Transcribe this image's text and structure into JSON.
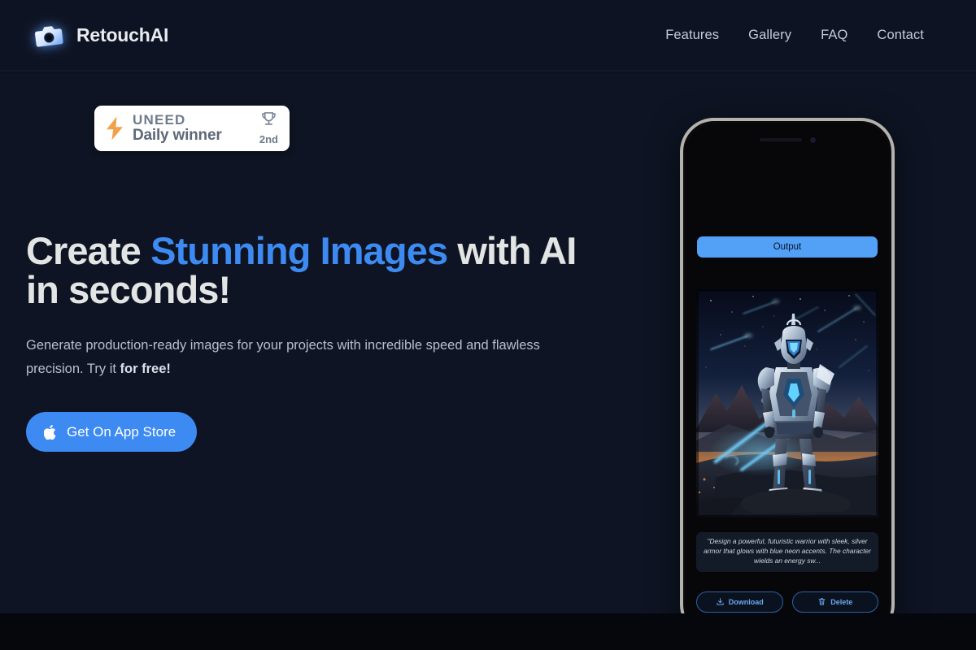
{
  "header": {
    "brand": {
      "name": "RetouchAI",
      "logo_icon": "camera-icon"
    },
    "nav": [
      {
        "label": "Features"
      },
      {
        "label": "Gallery"
      },
      {
        "label": "FAQ"
      },
      {
        "label": "Contact"
      }
    ]
  },
  "hero": {
    "badge": {
      "icon": "lightning-bolt-icon",
      "brand": "UNEED",
      "subtitle": "Daily winner",
      "trophy_icon": "trophy-icon",
      "rank": "2nd"
    },
    "headline": {
      "part1": "Create ",
      "accent": "Stunning Images",
      "part2": " with AI in seconds!"
    },
    "subheadline": {
      "text": "Generate production-ready images for your projects with incredible speed and flawless precision. Try it ",
      "bold": "for free!"
    },
    "cta": {
      "label": "Get On App Store",
      "icon": "apple-icon"
    }
  },
  "phone": {
    "tab": {
      "label": "Output"
    },
    "artwork": {
      "alt": "futuristic silver armored warrior holding a glowing blue energy sword on an alien rocky landscape at dusk"
    },
    "prompt": "\"Design a powerful, futuristic warrior with sleek, silver armor that glows with blue neon accents. The character wields an energy sw...",
    "actions": [
      {
        "label": "Download",
        "icon": "download-icon"
      },
      {
        "label": "Delete",
        "icon": "trash-icon"
      }
    ]
  },
  "colors": {
    "accent_blue": "#3d8bf2",
    "header_bg": "#0d1322",
    "hero_bg": "#0e1423",
    "page_bg": "#05070d",
    "badge_bg": "#ffffff",
    "bolt_orange": "#f5a councils",
    "bolt_orange_hex": "#f5a council",
    "text_light": "#e2e5e3"
  }
}
